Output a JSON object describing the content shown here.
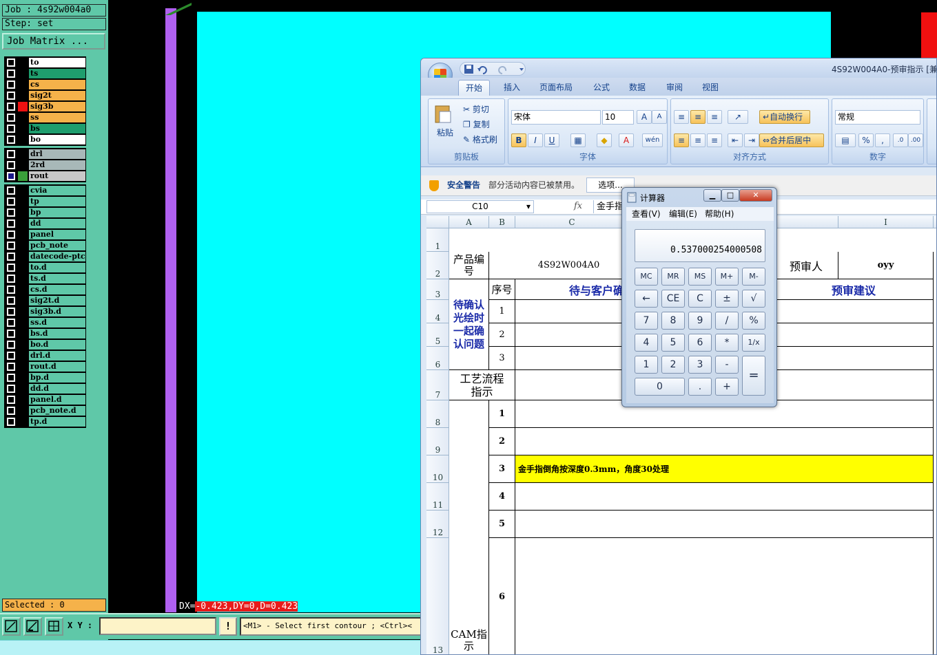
{
  "cam": {
    "job_label": "Job : 4s92w004a0",
    "step_label": "Step: set",
    "job_matrix": "Job Matrix ...",
    "selected": "Selected : 0",
    "dx_label": "DX=",
    "dx_value": "-0.423,DY=0,D=0.423",
    "xy_label": "X Y :",
    "xy_value": "",
    "prompt": "<M1> - Select first contour ; <Ctrl><",
    "warn": "!",
    "groups": [
      {
        "layers": [
          {
            "name": "to",
            "color": "#ffffff",
            "ind": ""
          },
          {
            "name": "ts",
            "color": "#1f9e6e",
            "ind": ""
          },
          {
            "name": "cs",
            "color": "#f5b24a",
            "ind": ""
          },
          {
            "name": "sig2t",
            "color": "#f5b24a",
            "ind": ""
          },
          {
            "name": "sig3b",
            "color": "#f5b24a",
            "ind": "#ee1111"
          },
          {
            "name": "ss",
            "color": "#f5b24a",
            "ind": ""
          },
          {
            "name": "bs",
            "color": "#1f9e6e",
            "ind": ""
          },
          {
            "name": "bo",
            "color": "#ffffff",
            "ind": ""
          }
        ]
      },
      {
        "layers": [
          {
            "name": "drl",
            "color": "#a8b8b8",
            "ind": ""
          },
          {
            "name": "2rd",
            "color": "#a8b8b8",
            "ind": ""
          },
          {
            "name": "rout",
            "color": "#c8c8c8",
            "ind": "#3aa03a",
            "checked": true
          }
        ]
      },
      {
        "layers": [
          {
            "name": "cvia",
            "color": "#5fc8a8",
            "ind": ""
          },
          {
            "name": "tp",
            "color": "#5fc8a8",
            "ind": ""
          },
          {
            "name": "bp",
            "color": "#5fc8a8",
            "ind": ""
          },
          {
            "name": "dd",
            "color": "#5fc8a8",
            "ind": ""
          },
          {
            "name": "panel",
            "color": "#5fc8a8",
            "ind": ""
          },
          {
            "name": "pcb_note",
            "color": "#5fc8a8",
            "ind": ""
          },
          {
            "name": "datecode-ptc",
            "color": "#5fc8a8",
            "ind": ""
          },
          {
            "name": "to.d",
            "color": "#5fc8a8",
            "ind": ""
          },
          {
            "name": "ts.d",
            "color": "#5fc8a8",
            "ind": ""
          },
          {
            "name": "cs.d",
            "color": "#5fc8a8",
            "ind": ""
          },
          {
            "name": "sig2t.d",
            "color": "#5fc8a8",
            "ind": ""
          },
          {
            "name": "sig3b.d",
            "color": "#5fc8a8",
            "ind": ""
          },
          {
            "name": "ss.d",
            "color": "#5fc8a8",
            "ind": ""
          },
          {
            "name": "bs.d",
            "color": "#5fc8a8",
            "ind": ""
          },
          {
            "name": "bo.d",
            "color": "#5fc8a8",
            "ind": ""
          },
          {
            "name": "drl.d",
            "color": "#5fc8a8",
            "ind": ""
          },
          {
            "name": "rout.d",
            "color": "#5fc8a8",
            "ind": ""
          },
          {
            "name": "bp.d",
            "color": "#5fc8a8",
            "ind": ""
          },
          {
            "name": "dd.d",
            "color": "#5fc8a8",
            "ind": ""
          },
          {
            "name": "panel.d",
            "color": "#5fc8a8",
            "ind": ""
          },
          {
            "name": "pcb_note.d",
            "color": "#5fc8a8",
            "ind": ""
          },
          {
            "name": "tp.d",
            "color": "#5fc8a8",
            "ind": ""
          }
        ]
      }
    ]
  },
  "excel": {
    "title": "4S92W004A0-预审指示 [兼",
    "tabs": [
      "开始",
      "插入",
      "页面布局",
      "公式",
      "数据",
      "审阅",
      "视图"
    ],
    "clipboard": {
      "paste": "粘贴",
      "cut": "剪切",
      "copy": "复制",
      "format_painter": "格式刷",
      "label": "剪贴板"
    },
    "font": {
      "name": "宋体",
      "size": "10",
      "label": "字体",
      "bold": "B",
      "italic": "I",
      "underline": "U",
      "grow": "A",
      "shrink": "A",
      "wen": "wén"
    },
    "alignment": {
      "wrap": "自动换行",
      "merge": "合并后居中",
      "label": "对齐方式"
    },
    "number": {
      "format": "常规",
      "percent": "%",
      "comma": ",",
      "label": "数字"
    },
    "security": {
      "label": "安全警告",
      "message": "部分活动内容已被禁用。",
      "options": "选项..."
    },
    "name_box": "C10",
    "fx": "fx",
    "formula": "金手指",
    "columns": [
      "A",
      "B",
      "C",
      "H",
      "I"
    ],
    "rows": [
      "1",
      "2",
      "3",
      "4",
      "5",
      "6",
      "7",
      "8",
      "9",
      "10",
      "11",
      "12",
      "13"
    ],
    "cells": {
      "product_no_label": "产品编号",
      "product_no": "4S92W004A0",
      "reviewer_label": "预审人",
      "reviewer": "oyy",
      "seq_label": "序号",
      "pending_label": "待与客户确",
      "review_advice": "预审建议",
      "pending_group": "待确认光绘时一起确认问题",
      "n1": "1",
      "n2": "2",
      "n3": "3",
      "n4": "4",
      "n5": "5",
      "n6": "6",
      "process_label": "工艺流程指示",
      "c10_text": "金手指倒角按深度0.3mm，角度30处理",
      "cam_label": "CAM指示"
    }
  },
  "calculator": {
    "title": "计算器",
    "menu": [
      "查看(V)",
      "编辑(E)",
      "帮助(H)"
    ],
    "display": "0.537000254000508",
    "keys": [
      [
        "MC",
        "MR",
        "MS",
        "M+",
        "M-"
      ],
      [
        "←",
        "CE",
        "C",
        "±",
        "√"
      ],
      [
        "7",
        "8",
        "9",
        "/",
        "%"
      ],
      [
        "4",
        "5",
        "6",
        "*",
        "1/x"
      ],
      [
        "1",
        "2",
        "3",
        "-",
        "="
      ],
      [
        "0",
        ".",
        "+"
      ]
    ]
  }
}
